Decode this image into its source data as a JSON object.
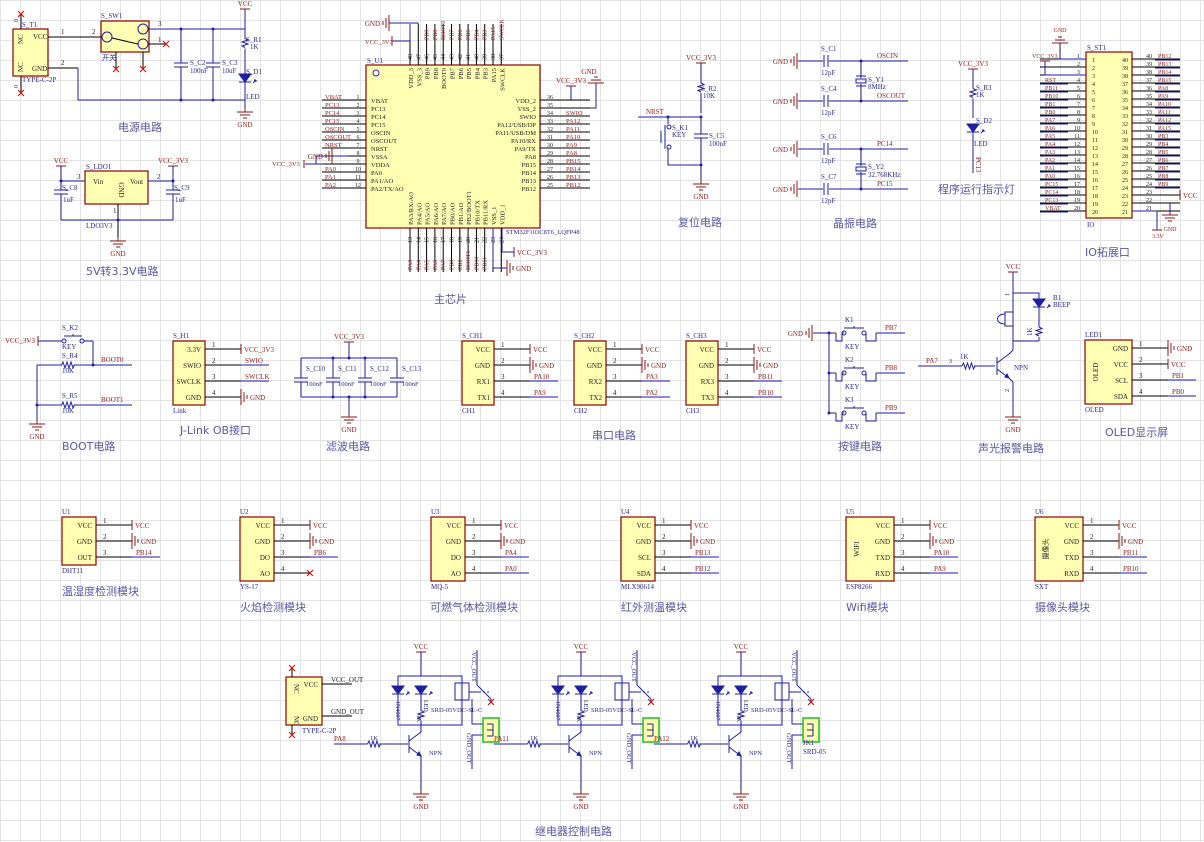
{
  "colors": {
    "wire": "#1f1fa0",
    "part": "#8b0000",
    "fill": "#ffffb4",
    "net": "#8b1a1a",
    "designator": "#2a2a8a",
    "title": "#5858a0",
    "connector": "#22bb22"
  },
  "nets": {
    "vcc": "VCC",
    "gnd": "GND",
    "vcc3v3": "VCC_3V3"
  },
  "sections": {
    "power": "电源电路",
    "ldo": "5V转3.3V电路",
    "mcu": "主芯片",
    "reset": "复位电路",
    "crystal": "晶振电路",
    "indicator": "程序运行指示灯",
    "io": "IO拓展口",
    "boot": "BOOT电路",
    "jlink": "J-Link OB接口",
    "filter": "滤波电路",
    "uart": "串口电路",
    "keys": "按键电路",
    "alarm": "声光报警电路",
    "oled": "OLED显示屏",
    "dht": "温湿度检测模块",
    "flame": "火焰检测模块",
    "gas": "可燃气体检测模块",
    "ir": "红外测温模块",
    "wifi": "Wifi模块",
    "camera": "摄像头模块",
    "relay": "继电器控制电路"
  },
  "power": {
    "t1": "S_T1",
    "vcc": "VCC",
    "gnd": "GND",
    "nc": "NC",
    "zero": "0",
    "fp": "TYPE-C-2P",
    "p1": "1",
    "p2": "2",
    "p3": "3",
    "sw": "S_SW1",
    "sw_name": "开关",
    "c2": "S_C2",
    "c2_v": "100nF",
    "c3": "S_C3",
    "c3_v": "10uF",
    "r1": "S_R1",
    "r1_v": "1K",
    "d1": "S_D1",
    "d1_v": "LED"
  },
  "ldo": {
    "u": "S_LDO1",
    "vin": "Vin",
    "vout": "Vout",
    "gnd": "GND",
    "fp": "LDO3V3",
    "c8": "S_C8",
    "c9": "S_C9",
    "cv": "1uF",
    "p1": "1",
    "p2": "2",
    "p3": "3"
  },
  "reset": {
    "nrst": "NRST",
    "r2": "S_R2",
    "r2_v": "10K",
    "k1": "S_K1",
    "key": "KEY",
    "c5": "S_C5",
    "c5_v": "100nF"
  },
  "crystal": {
    "c1": "S_C1",
    "c4": "S_C4",
    "c6": "S_C6",
    "c7": "S_C7",
    "cv": "12pF",
    "oscin": "OSCIN",
    "oscout": "OSCOUT",
    "pc14": "PC14",
    "pc15": "PC15",
    "y1": "S_Y1",
    "y1_v": "8MHz",
    "y2": "S_Y2",
    "y2_v": "32.768KHz"
  },
  "indicator": {
    "r3": "S_R3",
    "r3_v": "1K",
    "d2": "S_D2",
    "d2_v": "LED",
    "net": "PC13"
  },
  "boot": {
    "k2": "S_K2",
    "key": "KEY",
    "r4": "S_R4",
    "r5": "S_R5",
    "rv": "10K",
    "boot0": "BOOT0",
    "boot1": "BOOT1"
  },
  "filter": {
    "caps": [
      "S_C10",
      "S_C11",
      "S_C12",
      "S_C13"
    ],
    "cv": "100nF"
  },
  "keys": {
    "items": [
      {
        "ref": "K1",
        "net": "PB7"
      },
      {
        "ref": "K2",
        "net": "PB8"
      },
      {
        "ref": "K3",
        "net": "PB9"
      }
    ],
    "key": "KEY"
  },
  "alarm": {
    "b1": "B1",
    "beep": "BEEP",
    "r": "1K",
    "in": "PA7",
    "pin3": "3",
    "pin1": "1",
    "pin2": "2",
    "npn": "NPN"
  },
  "relay": {
    "t2_fp": "TYPE-C-2P",
    "vcc": "VCC",
    "gnd": "GND",
    "nc": "NC",
    "vcc_out": "VCC_OUT",
    "gnd_out": "GND_OUT",
    "diode": "1N4007",
    "led": "LED",
    "r": "1K",
    "relay_part": "SRD-05VDC-SL-C",
    "npn": "NPN",
    "inputs": [
      "PA8",
      "PA11",
      "PA12"
    ],
    "jk": "JK1",
    "jk_fp": "SRD-05"
  },
  "mcu": {
    "designator": "S_U1",
    "part": "STM32F103C8T6_LQFP48",
    "left": [
      {
        "num": "1",
        "name": "VBAT",
        "net": "VBAT"
      },
      {
        "num": "2",
        "name": "PC13",
        "net": "PC13"
      },
      {
        "num": "3",
        "name": "PC14",
        "net": "PC14"
      },
      {
        "num": "4",
        "name": "PC15",
        "net": "PC15"
      },
      {
        "num": "5",
        "name": "OSCIN",
        "net": "OSCIN"
      },
      {
        "num": "6",
        "name": "OSCOUT",
        "net": "OSCOUT"
      },
      {
        "num": "7",
        "name": "NRST",
        "net": "NRST"
      },
      {
        "num": "8",
        "name": "VSSA",
        "net": "GND"
      },
      {
        "num": "9",
        "name": "VDDA",
        "net": "VCC_3V3"
      },
      {
        "num": "10",
        "name": "PA0",
        "net": "PA0"
      },
      {
        "num": "11",
        "name": "PA1/AO",
        "net": "PA1"
      },
      {
        "num": "12",
        "name": "PA2/TX/AO",
        "net": "PA2"
      }
    ],
    "right": [
      {
        "num": "36",
        "name": "VDD_2",
        "net": ""
      },
      {
        "num": "35",
        "name": "VSS_2",
        "net": ""
      },
      {
        "num": "34",
        "name": "SWIO",
        "net": "SWIO"
      },
      {
        "num": "33",
        "name": "PA12/USB/DP",
        "net": "PA12"
      },
      {
        "num": "32",
        "name": "PA11/USB/DM",
        "net": "PA11"
      },
      {
        "num": "31",
        "name": "PA10/RX",
        "net": "PA10"
      },
      {
        "num": "30",
        "name": "PA9/TX",
        "net": "PA9"
      },
      {
        "num": "29",
        "name": "PA8",
        "net": "PA8"
      },
      {
        "num": "28",
        "name": "PB15",
        "net": "PB15"
      },
      {
        "num": "27",
        "name": "PB14",
        "net": "PB14"
      },
      {
        "num": "26",
        "name": "PB13",
        "net": "PB13"
      },
      {
        "num": "25",
        "name": "PB12",
        "net": "PB12"
      }
    ],
    "top": [
      {
        "num": "48",
        "name": "VDD_3",
        "net": ""
      },
      {
        "num": "47",
        "name": "VSS_3",
        "net": ""
      },
      {
        "num": "46",
        "name": "PB9",
        "net": "PB9"
      },
      {
        "num": "45",
        "name": "PB8",
        "net": "PB8"
      },
      {
        "num": "44",
        "name": "BOOT0",
        "net": "BOOT0"
      },
      {
        "num": "43",
        "name": "PB7",
        "net": "PB7"
      },
      {
        "num": "42",
        "name": "PB6",
        "net": "PB6"
      },
      {
        "num": "41",
        "name": "PB5",
        "net": "PB5"
      },
      {
        "num": "40",
        "name": "PB4",
        "net": "PB4"
      },
      {
        "num": "39",
        "name": "PB3",
        "net": "PB3"
      },
      {
        "num": "38",
        "name": "PA15",
        "net": "PA15"
      },
      {
        "num": "37",
        "name": "SWCLK",
        "net": "SWCLK"
      }
    ],
    "bottom": [
      {
        "num": "13",
        "name": "PA3/RX/AO",
        "net": "PA3"
      },
      {
        "num": "14",
        "name": "PA4/AO",
        "net": "PA4"
      },
      {
        "num": "15",
        "name": "PA5/AO",
        "net": "PA5"
      },
      {
        "num": "16",
        "name": "PA6/AO",
        "net": "PA6"
      },
      {
        "num": "17",
        "name": "PA7/AO",
        "net": "PA7"
      },
      {
        "num": "18",
        "name": "PB0/AO",
        "net": "PB0"
      },
      {
        "num": "19",
        "name": "PB1/AO",
        "net": "PB1"
      },
      {
        "num": "20",
        "name": "PB2/BOOT1",
        "net": "BOOT1"
      },
      {
        "num": "21",
        "name": "PB10/TX",
        "net": "PB10"
      },
      {
        "num": "22",
        "name": "PB11/RX",
        "net": "PB11"
      },
      {
        "num": "23",
        "name": "VSS_1",
        "net": ""
      },
      {
        "num": "24",
        "name": "VDD_1",
        "net": ""
      }
    ]
  },
  "io": {
    "designator": "S_ST1",
    "footprint": "IO",
    "v33": "3.3V",
    "left": [
      {
        "num": "1",
        "net": ""
      },
      {
        "num": "2",
        "net": ""
      },
      {
        "num": "3",
        "net": ""
      },
      {
        "num": "4",
        "net": "RST"
      },
      {
        "num": "5",
        "net": "PB11"
      },
      {
        "num": "6",
        "net": "PB10"
      },
      {
        "num": "7",
        "net": "PB1"
      },
      {
        "num": "8",
        "net": "PB0"
      },
      {
        "num": "9",
        "net": "PA7"
      },
      {
        "num": "10",
        "net": "PA6"
      },
      {
        "num": "11",
        "net": "PA5"
      },
      {
        "num": "12",
        "net": "PA4"
      },
      {
        "num": "13",
        "net": "PA3"
      },
      {
        "num": "14",
        "net": "PA2"
      },
      {
        "num": "15",
        "net": "PA1"
      },
      {
        "num": "16",
        "net": "PA0"
      },
      {
        "num": "17",
        "net": "PC15"
      },
      {
        "num": "18",
        "net": "PC14"
      },
      {
        "num": "19",
        "net": "PC13"
      },
      {
        "num": "20",
        "net": "VBAT"
      }
    ],
    "right": [
      {
        "num": "40",
        "net": "PB12"
      },
      {
        "num": "39",
        "net": "PB13"
      },
      {
        "num": "38",
        "net": "PB14"
      },
      {
        "num": "37",
        "net": "PB15"
      },
      {
        "num": "36",
        "net": "PA8"
      },
      {
        "num": "35",
        "net": "PA9"
      },
      {
        "num": "34",
        "net": "PA10"
      },
      {
        "num": "33",
        "net": "PA11"
      },
      {
        "num": "32",
        "net": "PA12"
      },
      {
        "num": "31",
        "net": "PA15"
      },
      {
        "num": "30",
        "net": "PB3"
      },
      {
        "num": "29",
        "net": "PB4"
      },
      {
        "num": "28",
        "net": "PB5"
      },
      {
        "num": "27",
        "net": "PB6"
      },
      {
        "num": "26",
        "net": "PB7"
      },
      {
        "num": "25",
        "net": "PB8"
      },
      {
        "num": "24",
        "net": "PB9"
      },
      {
        "num": "23",
        "net": ""
      },
      {
        "num": "22",
        "net": ""
      },
      {
        "num": "21",
        "net": ""
      }
    ]
  },
  "modules": {
    "jlink": {
      "designator": "S_H1",
      "footprint": "Link",
      "pins": [
        {
          "num": "1",
          "name": "3.3V",
          "net": "VCC_3V3"
        },
        {
          "num": "2",
          "name": "SWIO",
          "net": "SWIO"
        },
        {
          "num": "3",
          "name": "SWCLK",
          "net": "SWCLK"
        },
        {
          "num": "4",
          "name": "GND",
          "net": "GND"
        }
      ]
    },
    "ch1": {
      "designator": "S_CH1",
      "footprint": "CH1",
      "pins": [
        {
          "num": "1",
          "name": "VCC",
          "net": "VCC"
        },
        {
          "num": "2",
          "name": "GND",
          "net": "GND"
        },
        {
          "num": "3",
          "name": "RX1",
          "net": "PA10"
        },
        {
          "num": "4",
          "name": "TX1",
          "net": "PA9"
        }
      ]
    },
    "ch2": {
      "designator": "S_CH2",
      "footprint": "CH2",
      "pins": [
        {
          "num": "1",
          "name": "VCC",
          "net": "VCC"
        },
        {
          "num": "2",
          "name": "GND",
          "net": "GND"
        },
        {
          "num": "3",
          "name": "RX2",
          "net": "PA3"
        },
        {
          "num": "4",
          "name": "TX2",
          "net": "PA2"
        }
      ]
    },
    "ch3": {
      "designator": "S_CH3",
      "footprint": "CH3",
      "pins": [
        {
          "num": "1",
          "name": "VCC",
          "net": "VCC"
        },
        {
          "num": "2",
          "name": "GND",
          "net": "GND"
        },
        {
          "num": "3",
          "name": "RX3",
          "net": "PB11"
        },
        {
          "num": "4",
          "name": "TX3",
          "net": "PB10"
        }
      ]
    },
    "oled": {
      "designator": "LED1",
      "footprint": "OLED",
      "inner": "OLED",
      "pins": [
        {
          "num": "1",
          "name": "GND",
          "net": "GND"
        },
        {
          "num": "2",
          "name": "VCC",
          "net": "VCC"
        },
        {
          "num": "3",
          "name": "SCL",
          "net": "PB1"
        },
        {
          "num": "4",
          "name": "SDA",
          "net": "PB0"
        }
      ]
    },
    "u1": {
      "designator": "U1",
      "footprint": "DHT11",
      "pins": [
        {
          "num": "1",
          "name": "VCC",
          "net": "VCC"
        },
        {
          "num": "2",
          "name": "GND",
          "net": "GND"
        },
        {
          "num": "3",
          "name": "OUT",
          "net": "PB14"
        }
      ]
    },
    "u2": {
      "designator": "U2",
      "footprint": "YS-17",
      "pins": [
        {
          "num": "1",
          "name": "VCC",
          "net": "VCC"
        },
        {
          "num": "2",
          "name": "GND",
          "net": "GND"
        },
        {
          "num": "3",
          "name": "DO",
          "net": "PB6"
        },
        {
          "num": "4",
          "name": "AO",
          "net": ""
        }
      ]
    },
    "u3": {
      "designator": "U3",
      "footprint": "MQ-5",
      "pins": [
        {
          "num": "1",
          "name": "VCC",
          "net": "VCC"
        },
        {
          "num": "2",
          "name": "GND",
          "net": "GND"
        },
        {
          "num": "3",
          "name": "DO",
          "net": "PA4"
        },
        {
          "num": "4",
          "name": "AO",
          "net": "PA0"
        }
      ]
    },
    "u4": {
      "designator": "U4",
      "footprint": "MLX90614",
      "pins": [
        {
          "num": "1",
          "name": "VCC",
          "net": "VCC"
        },
        {
          "num": "2",
          "name": "GND",
          "net": "GND"
        },
        {
          "num": "3",
          "name": "SCL",
          "net": "PB13"
        },
        {
          "num": "4",
          "name": "SDA",
          "net": "PB12"
        }
      ]
    },
    "u5": {
      "designator": "U5",
      "footprint": "ESP8266",
      "inner": "WIFI",
      "pins": [
        {
          "num": "1",
          "name": "VCC",
          "net": "VCC"
        },
        {
          "num": "2",
          "name": "GND",
          "net": "GND"
        },
        {
          "num": "3",
          "name": "TXD",
          "net": "PA10"
        },
        {
          "num": "4",
          "name": "RXD",
          "net": "PA9"
        }
      ]
    },
    "u6": {
      "designator": "U6",
      "footprint": "SXT",
      "inner": "摄像头",
      "pins": [
        {
          "num": "1",
          "name": "VCC",
          "net": "VCC"
        },
        {
          "num": "2",
          "name": "GND",
          "net": "GND"
        },
        {
          "num": "3",
          "name": "TXD",
          "net": "PB11"
        },
        {
          "num": "4",
          "name": "RXD",
          "net": "PB10"
        }
      ]
    }
  }
}
